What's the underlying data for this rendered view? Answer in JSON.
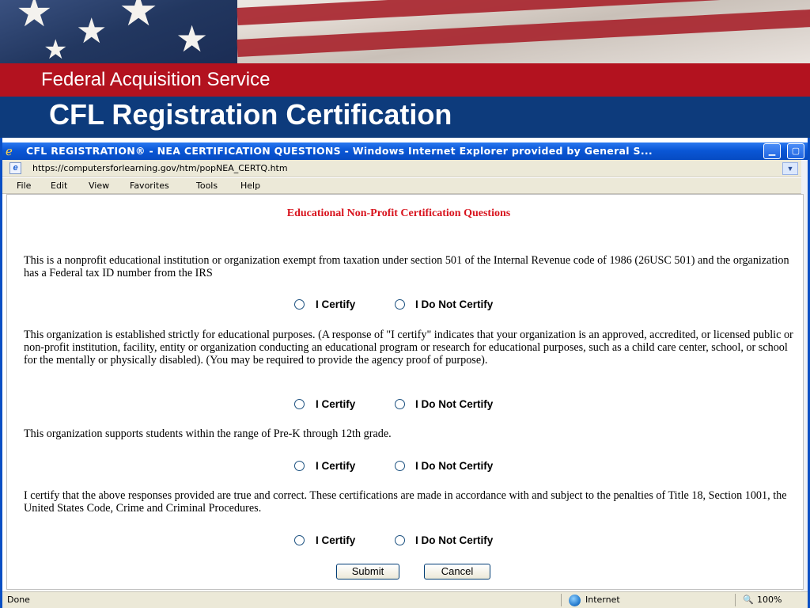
{
  "slide": {
    "section": "Federal Acquisition Service",
    "title": "CFL Registration Certification"
  },
  "browser": {
    "window_title": "CFL REGISTRATION® - NEA CERTIFICATION QUESTIONS - Windows Internet Explorer provided by General S...",
    "url": "https://computersforlearning.gov/htm/popNEA_CERTQ.htm",
    "menu": [
      "File",
      "Edit",
      "View",
      "Favorites",
      "Tools",
      "Help"
    ],
    "status": {
      "left": "Done",
      "zone": "Internet",
      "zoom": "100%"
    }
  },
  "form": {
    "heading": "Educational Non-Profit Certification Questions",
    "questions": [
      {
        "text": "This is a nonprofit educational institution or organization exempt from taxation under section 501 of the Internal Revenue code of 1986 (26USC 501) and the organization has a Federal tax ID number from the IRS",
        "option_yes": "I Certify",
        "option_no": "I Do Not Certify"
      },
      {
        "text": "This organization is established strictly for educational purposes. (A response of \"I certify\" indicates that your organization is an approved, accredited, or licensed public or non-profit institution, facility, entity or organization conducting an educational program or research for educational purposes, such as a child care center, school, or school for the mentally or physically disabled). (You may be required to provide the agency proof of purpose).",
        "option_yes": "I Certify",
        "option_no": "I Do Not Certify"
      },
      {
        "text": "This organization supports students within the range of Pre-K through 12th grade.",
        "option_yes": "I Certify",
        "option_no": "I Do Not Certify"
      },
      {
        "text": "I certify that the above responses provided are true and correct. These certifications are made in accordance with and subject to the penalties of Title 18, Section 1001, the United States Code, Crime and Criminal Procedures.",
        "option_yes": "I Certify",
        "option_no": "I Do Not Certify"
      }
    ],
    "submit_label": "Submit",
    "cancel_label": "Cancel"
  }
}
